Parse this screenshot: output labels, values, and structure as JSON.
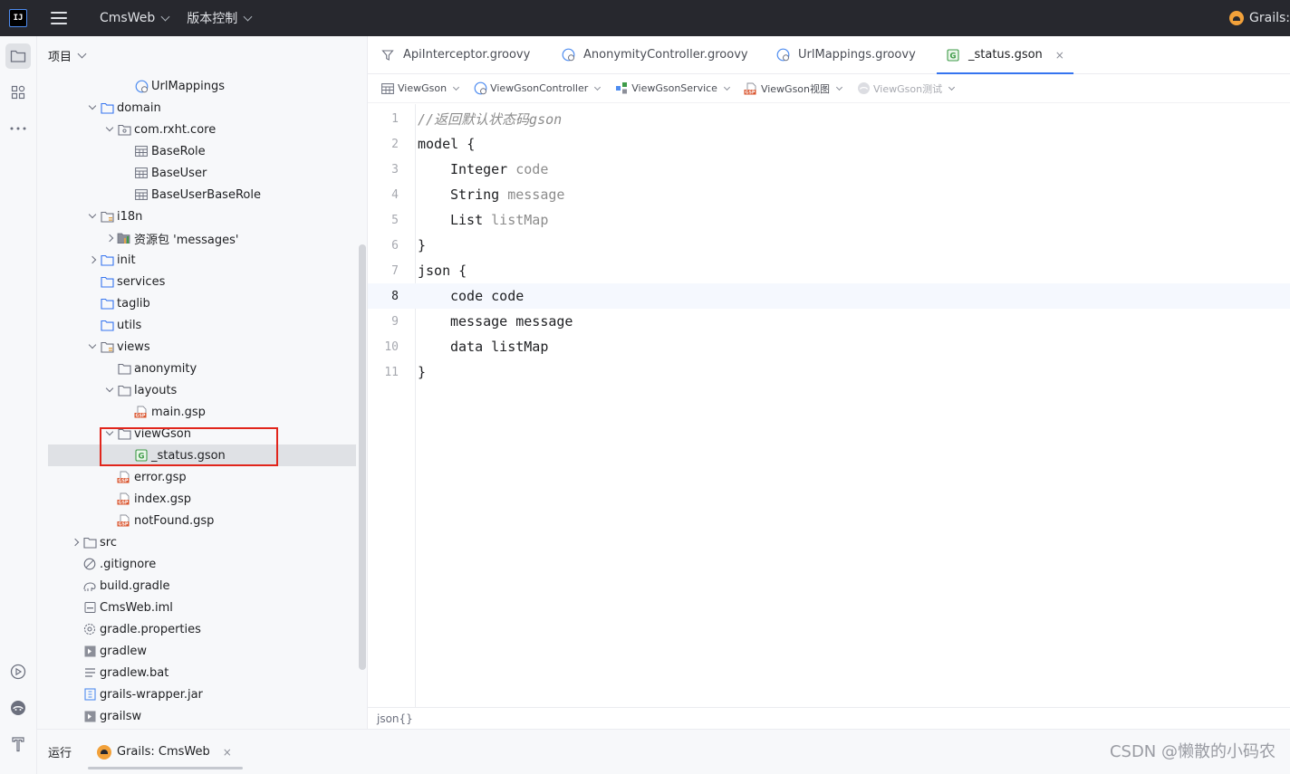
{
  "titlebar": {
    "logo": "IJ",
    "project_name": "CmsWeb",
    "vcs_label": "版本控制",
    "run_config": "Grails:"
  },
  "project_panel": {
    "header": "项目",
    "tree": [
      {
        "label": "UrlMappings",
        "icon": "groovy-class-icon",
        "level": 5,
        "chevron": "none"
      },
      {
        "label": "domain",
        "icon": "folder-icon",
        "level": 3,
        "chevron": "down"
      },
      {
        "label": "com.rxht.core",
        "icon": "package-icon",
        "level": 4,
        "chevron": "down"
      },
      {
        "label": "BaseRole",
        "icon": "table-icon",
        "level": 5,
        "chevron": "none"
      },
      {
        "label": "BaseUser",
        "icon": "table-icon",
        "level": 5,
        "chevron": "none"
      },
      {
        "label": "BaseUserBaseRole",
        "icon": "table-icon",
        "level": 5,
        "chevron": "none"
      },
      {
        "label": "i18n",
        "icon": "resource-folder-icon",
        "level": 3,
        "chevron": "down"
      },
      {
        "label": "资源包 'messages'",
        "icon": "resource-bundle-icon",
        "level": 4,
        "chevron": "right"
      },
      {
        "label": "init",
        "icon": "folder-icon",
        "level": 3,
        "chevron": "right"
      },
      {
        "label": "services",
        "icon": "folder-icon",
        "level": 3,
        "chevron": "none"
      },
      {
        "label": "taglib",
        "icon": "folder-icon",
        "level": 3,
        "chevron": "none"
      },
      {
        "label": "utils",
        "icon": "folder-icon",
        "level": 3,
        "chevron": "none"
      },
      {
        "label": "views",
        "icon": "resource-folder-icon",
        "level": 3,
        "chevron": "down"
      },
      {
        "label": "anonymity",
        "icon": "plain-folder-icon",
        "level": 4,
        "chevron": "none"
      },
      {
        "label": "layouts",
        "icon": "plain-folder-icon",
        "level": 4,
        "chevron": "down"
      },
      {
        "label": "main.gsp",
        "icon": "gsp-file-icon",
        "level": 5,
        "chevron": "none"
      },
      {
        "label": "viewGson",
        "icon": "plain-folder-icon",
        "level": 4,
        "chevron": "down"
      },
      {
        "label": "_status.gson",
        "icon": "gson-file-icon",
        "level": 5,
        "chevron": "none",
        "selected": true
      },
      {
        "label": "error.gsp",
        "icon": "gsp-file-icon",
        "level": 4,
        "chevron": "none"
      },
      {
        "label": "index.gsp",
        "icon": "gsp-file-icon",
        "level": 4,
        "chevron": "none"
      },
      {
        "label": "notFound.gsp",
        "icon": "gsp-file-icon",
        "level": 4,
        "chevron": "none"
      },
      {
        "label": "src",
        "icon": "plain-folder-icon",
        "level": 2,
        "chevron": "right"
      },
      {
        "label": ".gitignore",
        "icon": "ignore-file-icon",
        "level": 2,
        "chevron": "none"
      },
      {
        "label": "build.gradle",
        "icon": "gradle-icon",
        "level": 2,
        "chevron": "none"
      },
      {
        "label": "CmsWeb.iml",
        "icon": "iml-file-icon",
        "level": 2,
        "chevron": "none"
      },
      {
        "label": "gradle.properties",
        "icon": "settings-file-icon",
        "level": 2,
        "chevron": "none"
      },
      {
        "label": "gradlew",
        "icon": "script-file-icon",
        "level": 2,
        "chevron": "none"
      },
      {
        "label": "gradlew.bat",
        "icon": "text-file-icon",
        "level": 2,
        "chevron": "none"
      },
      {
        "label": "grails-wrapper.jar",
        "icon": "jar-file-icon",
        "level": 2,
        "chevron": "none"
      },
      {
        "label": "grailsw",
        "icon": "script-file-icon",
        "level": 2,
        "chevron": "none"
      }
    ]
  },
  "editor": {
    "tabs": [
      {
        "label": "ApiInterceptor.groovy",
        "icon": "interceptor-icon"
      },
      {
        "label": "AnonymityController.groovy",
        "icon": "groovy-class-icon"
      },
      {
        "label": "UrlMappings.groovy",
        "icon": "groovy-class-icon"
      },
      {
        "label": "_status.gson",
        "icon": "gson-file-icon",
        "active": true
      }
    ],
    "close_glyph": "×",
    "breadcrumbs": [
      {
        "label": "ViewGson",
        "icon": "table-icon",
        "dim": false
      },
      {
        "label": "ViewGsonController",
        "icon": "groovy-class-icon",
        "dim": false
      },
      {
        "label": "ViewGsonService",
        "icon": "service-icon",
        "dim": false
      },
      {
        "label": "ViewGson视图",
        "icon": "gsp-file-icon",
        "dim": false
      },
      {
        "label": "ViewGson测试",
        "icon": "grails-icon",
        "dim": true
      }
    ],
    "current_line": 8,
    "code_lines": [
      {
        "n": "1",
        "tokens": [
          {
            "t": "//返回默认状态码gson",
            "c": "cmt"
          }
        ]
      },
      {
        "n": "2",
        "tokens": [
          {
            "t": "model ",
            "c": "kw"
          },
          {
            "t": "{",
            "c": "kw"
          }
        ]
      },
      {
        "n": "3",
        "indent": true,
        "tokens": [
          {
            "t": "Integer ",
            "c": "kw"
          },
          {
            "t": "code",
            "c": "unused"
          }
        ]
      },
      {
        "n": "4",
        "indent": true,
        "tokens": [
          {
            "t": "String ",
            "c": "kw"
          },
          {
            "t": "message",
            "c": "unused"
          }
        ]
      },
      {
        "n": "5",
        "indent": true,
        "tokens": [
          {
            "t": "List ",
            "c": "kw"
          },
          {
            "t": "listMap",
            "c": "unused"
          }
        ]
      },
      {
        "n": "6",
        "tokens": [
          {
            "t": "}",
            "c": "kw"
          }
        ]
      },
      {
        "n": "7",
        "tokens": [
          {
            "t": "json ",
            "c": "kw"
          },
          {
            "t": "{",
            "c": "kw"
          }
        ]
      },
      {
        "n": "8",
        "indent": true,
        "tokens": [
          {
            "t": "code code",
            "c": "kw"
          }
        ]
      },
      {
        "n": "9",
        "indent": true,
        "tokens": [
          {
            "t": "message message",
            "c": "kw"
          }
        ]
      },
      {
        "n": "10",
        "indent": true,
        "tokens": [
          {
            "t": "data listMap",
            "c": "kw"
          }
        ]
      },
      {
        "n": "11",
        "tokens": [
          {
            "t": "}",
            "c": "kw"
          }
        ]
      }
    ],
    "status_breadcrumb": "json{}"
  },
  "bottom": {
    "run_label": "运行",
    "run_tab": "Grails: CmsWeb",
    "watermark": "CSDN @懒散的小码农"
  },
  "colors": {
    "accent": "#3574f0",
    "highlight_box": "#e1251b",
    "titlebar_bg": "#27282e"
  }
}
